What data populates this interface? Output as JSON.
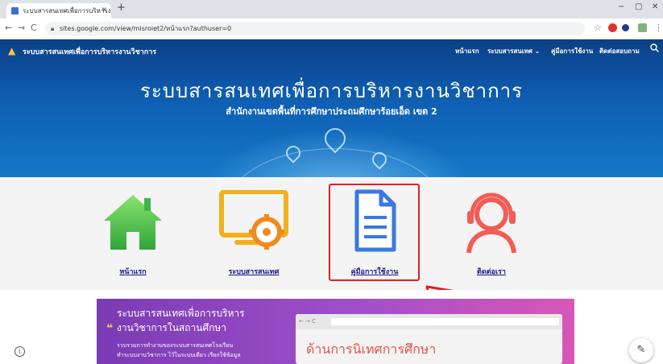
{
  "browser": {
    "tab_title": "ระบบสารสนเทศเพื่อการบริหารงานวิชาการ",
    "tab_close": "✕",
    "new_tab": "+",
    "window_controls": {
      "minimize": "−",
      "maximize": "▢",
      "close": "✕"
    },
    "nav": {
      "back": "←",
      "forward": "→",
      "reload": "C"
    },
    "url": "sites.google.com/view/misroiet2/หน้าแรก?authuser=0",
    "star": "☆"
  },
  "site": {
    "logo_glyph": "🔥",
    "title": "ระบบสารสนเทศเพื่อการบริหารงานวิชาการ",
    "nav": [
      "หน้าแรก",
      "ระบบสารสนเทศ ⌄",
      "คู่มือการใช้งาน",
      "ติดต่อสอบถาม"
    ],
    "search_icon": "search-icon"
  },
  "hero": {
    "title": "ระบบสารสนเทศเพื่อการบริหารงานวิชาการ",
    "subtitle": "สำนักงานเขตพื้นที่การศึกษาประถมศึกษาร้อยเอ็ด เขต 2"
  },
  "quick_links": [
    {
      "label": "หน้าแรก",
      "icon": "home-icon",
      "color": "#4cc24a"
    },
    {
      "label": "ระบบสารสนเทศ",
      "icon": "monitor-gear-icon",
      "color": "#f2b01e"
    },
    {
      "label": "คู่มือการใช้งาน",
      "icon": "document-icon",
      "color": "#3a78e0"
    },
    {
      "label": "ติดต่อเรา",
      "icon": "headset-icon",
      "color": "#f25c54"
    }
  ],
  "banner": {
    "title_line1": "ระบบสารสนเทศเพื่อการบริหาร",
    "title_line2": "งานวิชาการในสถานศึกษา",
    "desc_line1": "รวบรวมการทำงานของระบบสารสนเทศโรงเรียน",
    "desc_line2": "ทำระบบงานวิชาการ ไว้ในระบบเดียว เรียกใช้ข้อมูล",
    "mock_heading": "ด้านการนิเทศการศึกษา"
  },
  "colors": {
    "header_blue": "#0f5fb3",
    "highlight_red": "#e02020",
    "banner_purple": "#a14fc9"
  }
}
